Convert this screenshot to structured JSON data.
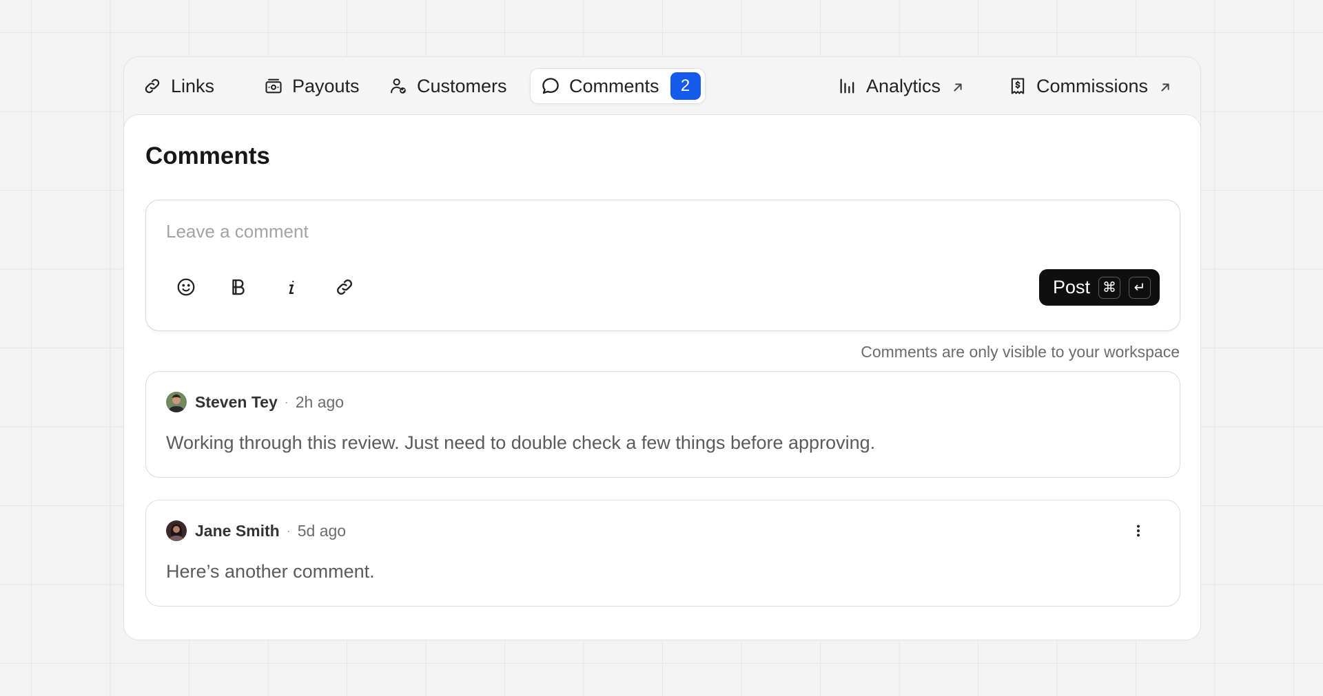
{
  "tabs": [
    {
      "label": "Links",
      "icon": "link-icon"
    },
    {
      "label": "Payouts",
      "icon": "payouts-icon"
    },
    {
      "label": "Customers",
      "icon": "customers-icon"
    },
    {
      "label": "Comments",
      "icon": "comment-icon",
      "badge": "2",
      "active": true
    },
    {
      "label": "Analytics",
      "icon": "bar-chart-icon",
      "external": true
    },
    {
      "label": "Commissions",
      "icon": "receipt-icon",
      "external": true
    }
  ],
  "page": {
    "title": "Comments"
  },
  "composer": {
    "placeholder": "Leave a comment",
    "tools": [
      "emoji-icon",
      "bold-icon",
      "italic-icon",
      "link-icon"
    ],
    "post_label": "Post",
    "shortcut_cmd": "⌘",
    "shortcut_enter": "↵"
  },
  "visibility_note": "Comments are only visible to your workspace",
  "comments": [
    {
      "author": "Steven Tey",
      "separator": "·",
      "time": "2h ago",
      "body": "Working through this review. Just need to double check a few things before approving."
    },
    {
      "author": "Jane Smith",
      "separator": "·",
      "time": "5d ago",
      "body": "Here’s another comment."
    }
  ],
  "colors": {
    "accent": "#1559ed",
    "primary_button": "#0f0f0f"
  }
}
